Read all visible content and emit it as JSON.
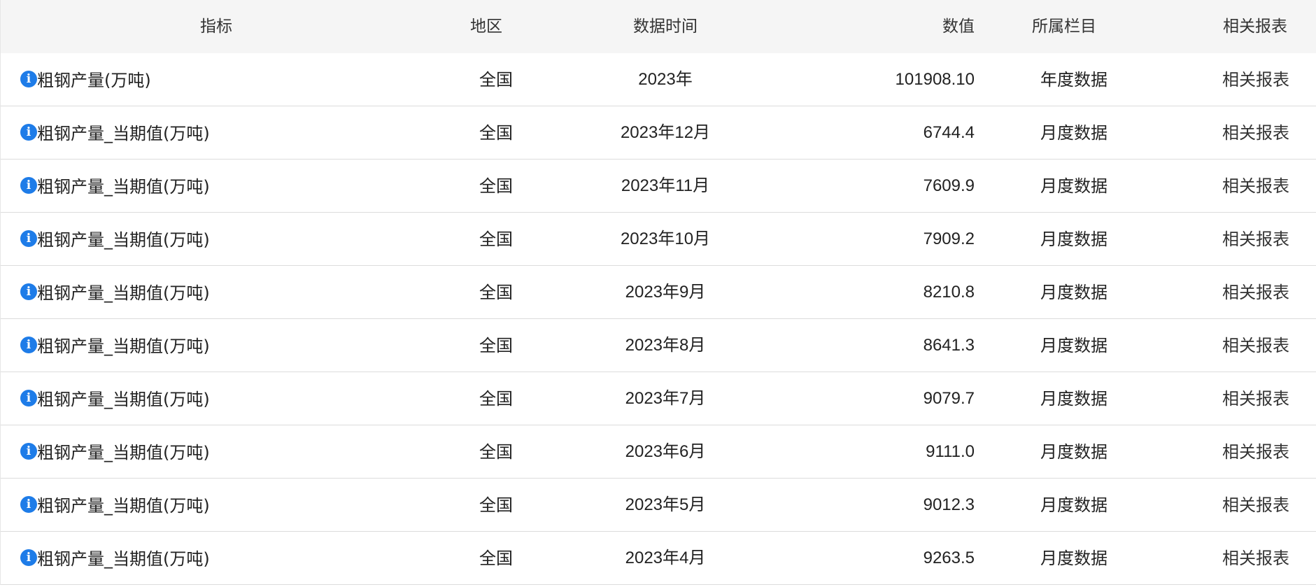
{
  "table": {
    "headers": {
      "indicator": "指标",
      "region": "地区",
      "time": "数据时间",
      "value": "数值",
      "column": "所属栏目",
      "report": "相关报表"
    },
    "rows": [
      {
        "indicator": "粗钢产量(万吨)",
        "region": "全国",
        "time": "2023年",
        "value": "101908.10",
        "column": "年度数据",
        "report": "相关报表"
      },
      {
        "indicator": "粗钢产量_当期值(万吨)",
        "region": "全国",
        "time": "2023年12月",
        "value": "6744.4",
        "column": "月度数据",
        "report": "相关报表"
      },
      {
        "indicator": "粗钢产量_当期值(万吨)",
        "region": "全国",
        "time": "2023年11月",
        "value": "7609.9",
        "column": "月度数据",
        "report": "相关报表"
      },
      {
        "indicator": "粗钢产量_当期值(万吨)",
        "region": "全国",
        "time": "2023年10月",
        "value": "7909.2",
        "column": "月度数据",
        "report": "相关报表"
      },
      {
        "indicator": "粗钢产量_当期值(万吨)",
        "region": "全国",
        "time": "2023年9月",
        "value": "8210.8",
        "column": "月度数据",
        "report": "相关报表"
      },
      {
        "indicator": "粗钢产量_当期值(万吨)",
        "region": "全国",
        "time": "2023年8月",
        "value": "8641.3",
        "column": "月度数据",
        "report": "相关报表"
      },
      {
        "indicator": "粗钢产量_当期值(万吨)",
        "region": "全国",
        "time": "2023年7月",
        "value": "9079.7",
        "column": "月度数据",
        "report": "相关报表"
      },
      {
        "indicator": "粗钢产量_当期值(万吨)",
        "region": "全国",
        "time": "2023年6月",
        "value": "9111.0",
        "column": "月度数据",
        "report": "相关报表"
      },
      {
        "indicator": "粗钢产量_当期值(万吨)",
        "region": "全国",
        "time": "2023年5月",
        "value": "9012.3",
        "column": "月度数据",
        "report": "相关报表"
      },
      {
        "indicator": "粗钢产量_当期值(万吨)",
        "region": "全国",
        "time": "2023年4月",
        "value": "9263.5",
        "column": "月度数据",
        "report": "相关报表"
      }
    ],
    "info_icon": {
      "name": "info-icon",
      "glyph": "i",
      "color": "#1e7ce8"
    }
  }
}
